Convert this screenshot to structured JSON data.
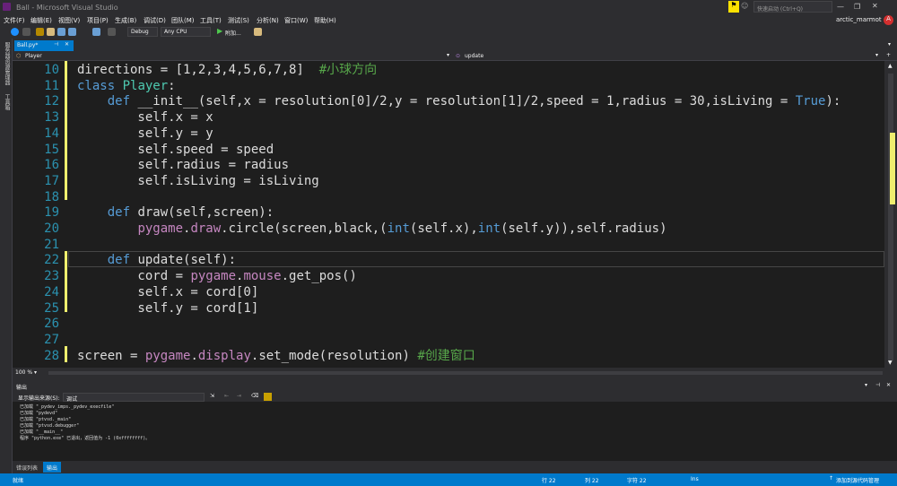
{
  "window": {
    "title": "Ball - Microsoft Visual Studio",
    "quick_launch": "快速启动 (Ctrl+Q)",
    "user": "arctic_marmot",
    "avatar_letter": "A"
  },
  "menu": [
    "文件(F)",
    "编辑(E)",
    "视图(V)",
    "项目(P)",
    "生成(B)",
    "调试(D)",
    "团队(M)",
    "工具(T)",
    "测试(S)",
    "分析(N)",
    "窗口(W)",
    "帮助(H)"
  ],
  "toolbar": {
    "config": "Debug",
    "platform": "Any CPU",
    "run_label": "附加..."
  },
  "left_tabs": [
    "服务器资源管理器",
    "工具箱"
  ],
  "tab": {
    "name": "Ball.py*"
  },
  "nav": {
    "left": "Player",
    "right": "update"
  },
  "code": [
    {
      "n": "10",
      "t": "directions = [1,2,3,4,5,6,7,8]  ",
      "c": "#小球方向"
    },
    {
      "n": "11",
      "t": "class Player:"
    },
    {
      "n": "12",
      "t": "    def __init__(self,x = resolution[0]/2,y = resolution[1]/2,speed = 1,radius = 30,isLiving = True):"
    },
    {
      "n": "13",
      "t": "        self.x = x"
    },
    {
      "n": "14",
      "t": "        self.y = y"
    },
    {
      "n": "15",
      "t": "        self.speed = speed"
    },
    {
      "n": "16",
      "t": "        self.radius = radius"
    },
    {
      "n": "17",
      "t": "        self.isLiving = isLiving"
    },
    {
      "n": "18",
      "t": ""
    },
    {
      "n": "19",
      "t": "    def draw(self,screen):"
    },
    {
      "n": "20",
      "t": "        pygame.draw.circle(screen,black,(int(self.x),int(self.y)),self.radius)"
    },
    {
      "n": "21",
      "t": ""
    },
    {
      "n": "22",
      "t": "    def update(self):"
    },
    {
      "n": "23",
      "t": "        cord = pygame.mouse.get_pos()"
    },
    {
      "n": "24",
      "t": "        self.x = cord[0]"
    },
    {
      "n": "25",
      "t": "        self.y = cord[1]"
    },
    {
      "n": "26",
      "t": ""
    },
    {
      "n": "27",
      "t": ""
    },
    {
      "n": "28",
      "t": "screen = pygame.display.set_mode(resolution) ",
      "c": "#创建窗口"
    }
  ],
  "zoom": "100 %",
  "output": {
    "title": "输出",
    "source_label": "显示输出来源(S):",
    "source_value": "调试",
    "lines": [
      "已加载 \"_pydev_imps._pydev_execfile\"",
      "已加载 \"pydevd\"",
      "已加载 \"ptvsd._main\"",
      "已加载 \"ptvsd.debugger\"",
      "已加载 \"__main__\"",
      "程序 \"python.exe\" 已退出，返回值为 -1 (0xffffffff)。"
    ]
  },
  "bottom_tabs": [
    "错误列表",
    "输出"
  ],
  "status": {
    "ready": "就绪",
    "line": "行 22",
    "col": "列 22",
    "char": "字符 22",
    "mode": "Ins",
    "source_control": "添加到源代码管理"
  }
}
